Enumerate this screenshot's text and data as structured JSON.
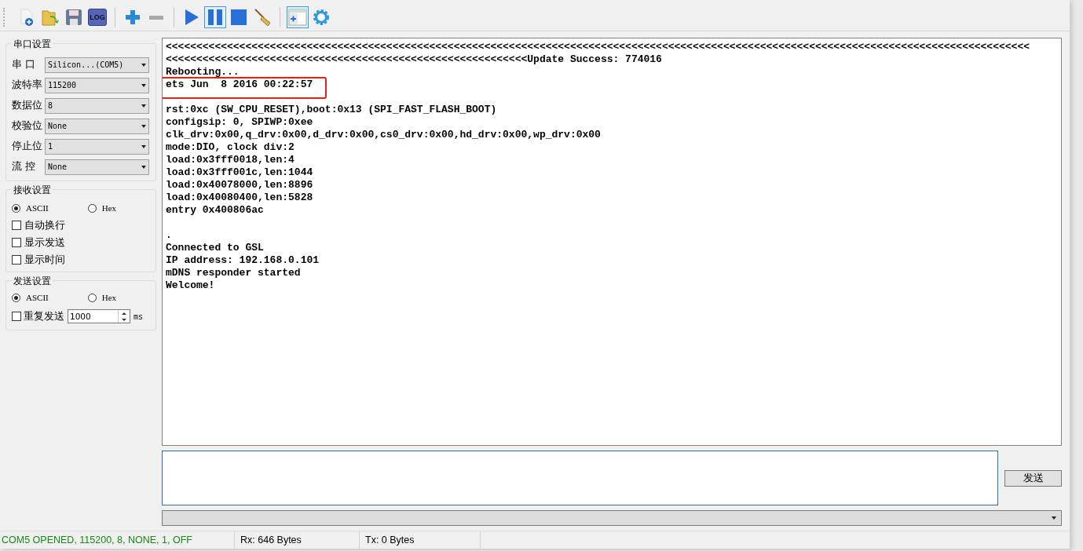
{
  "toolbar": [
    [
      {
        "kind": "new-file",
        "selected": false
      },
      {
        "kind": "open-folder",
        "selected": false
      },
      {
        "kind": "save",
        "selected": false
      },
      {
        "kind": "log",
        "label": "LOG",
        "selected": false
      }
    ],
    [
      {
        "kind": "add",
        "selected": false
      },
      {
        "kind": "remove",
        "selected": false
      }
    ],
    [
      {
        "kind": "play",
        "selected": false
      },
      {
        "kind": "pause",
        "selected": true
      },
      {
        "kind": "stop",
        "selected": false
      },
      {
        "kind": "broom",
        "selected": false
      }
    ],
    [
      {
        "kind": "panel-add",
        "selected": true
      },
      {
        "kind": "gear",
        "selected": false
      }
    ]
  ],
  "serial_settings": {
    "title": "串口设置",
    "fields": [
      {
        "label": "串 口",
        "value": "Silicon...(COM5)"
      },
      {
        "label": "波特率",
        "value": "115200"
      },
      {
        "label": "数据位",
        "value": "8"
      },
      {
        "label": "校验位",
        "value": "None"
      },
      {
        "label": "停止位",
        "value": "1"
      },
      {
        "label": "流 控",
        "value": "None"
      }
    ]
  },
  "receive_settings": {
    "title": "接收设置",
    "modes": [
      {
        "label": "ASCII",
        "selected": true
      },
      {
        "label": "Hex",
        "selected": false
      }
    ],
    "options": [
      {
        "label": "自动换行",
        "checked": false
      },
      {
        "label": "显示发送",
        "checked": false
      },
      {
        "label": "显示时间",
        "checked": false
      }
    ]
  },
  "send_settings": {
    "title": "发送设置",
    "modes": [
      {
        "label": "ASCII",
        "selected": true
      },
      {
        "label": "Hex",
        "selected": false
      }
    ],
    "repeat": {
      "label": "重复发送",
      "checked": false,
      "value": "1000",
      "unit": "ms"
    }
  },
  "log": {
    "blocks": [
      [
        {
          "text": "<<<<<<<<<<<<<<<<<<<<<<<<<<<<<<<<<<<<<<<<<<<<<<<<<<<<<<<<<<<<<<<<<<<<<<<<<<<<<<<<<<<<<<<<<<<<<<<<<<<<<<<<<<<<<<<<<<<<<<<<<<<<<<<<<<<<<<<<<<<<<",
          "highlighted": false
        },
        {
          "text": "<<<<<<<<<<<<<<<<<<<<<<<<<<<<<<<<<<<<<<<<<<<<<<<<<<<<<<<<<<<Update Success: 774016",
          "highlighted": false
        },
        {
          "text": "Rebooting...",
          "highlighted": false
        },
        {
          "text": "ets Jun  8 2016 00:22:57",
          "highlighted": true
        }
      ],
      [
        {
          "text": "rst:0xc (SW_CPU_RESET),boot:0x13 (SPI_FAST_FLASH_BOOT)",
          "highlighted": false
        },
        {
          "text": "configsip: 0, SPIWP:0xee",
          "highlighted": false
        },
        {
          "text": "clk_drv:0x00,q_drv:0x00,d_drv:0x00,cs0_drv:0x00,hd_drv:0x00,wp_drv:0x00",
          "highlighted": false
        },
        {
          "text": "mode:DIO, clock div:2",
          "highlighted": false
        },
        {
          "text": "load:0x3fff0018,len:4",
          "highlighted": false
        },
        {
          "text": "load:0x3fff001c,len:1044",
          "highlighted": false
        },
        {
          "text": "load:0x40078000,len:8896",
          "highlighted": false
        },
        {
          "text": "load:0x40080400,len:5828",
          "highlighted": false
        },
        {
          "text": "entry 0x400806ac",
          "highlighted": false
        }
      ],
      [
        {
          "text": ".",
          "highlighted": false
        },
        {
          "text": "Connected to GSL",
          "highlighted": false
        },
        {
          "text": "IP address: 192.168.0.101",
          "highlighted": false
        },
        {
          "text": "mDNS responder started",
          "highlighted": false
        },
        {
          "text": "Welcome!",
          "highlighted": false
        }
      ]
    ]
  },
  "send_button": "发送",
  "status_bar": [
    {
      "text": "COM5 OPENED, 115200, 8, NONE, 1, OFF",
      "color": "#16891a"
    },
    {
      "text": "Rx: 646 Bytes",
      "color": "#000000"
    },
    {
      "text": "Tx: 0 Bytes",
      "color": "#000000"
    }
  ]
}
